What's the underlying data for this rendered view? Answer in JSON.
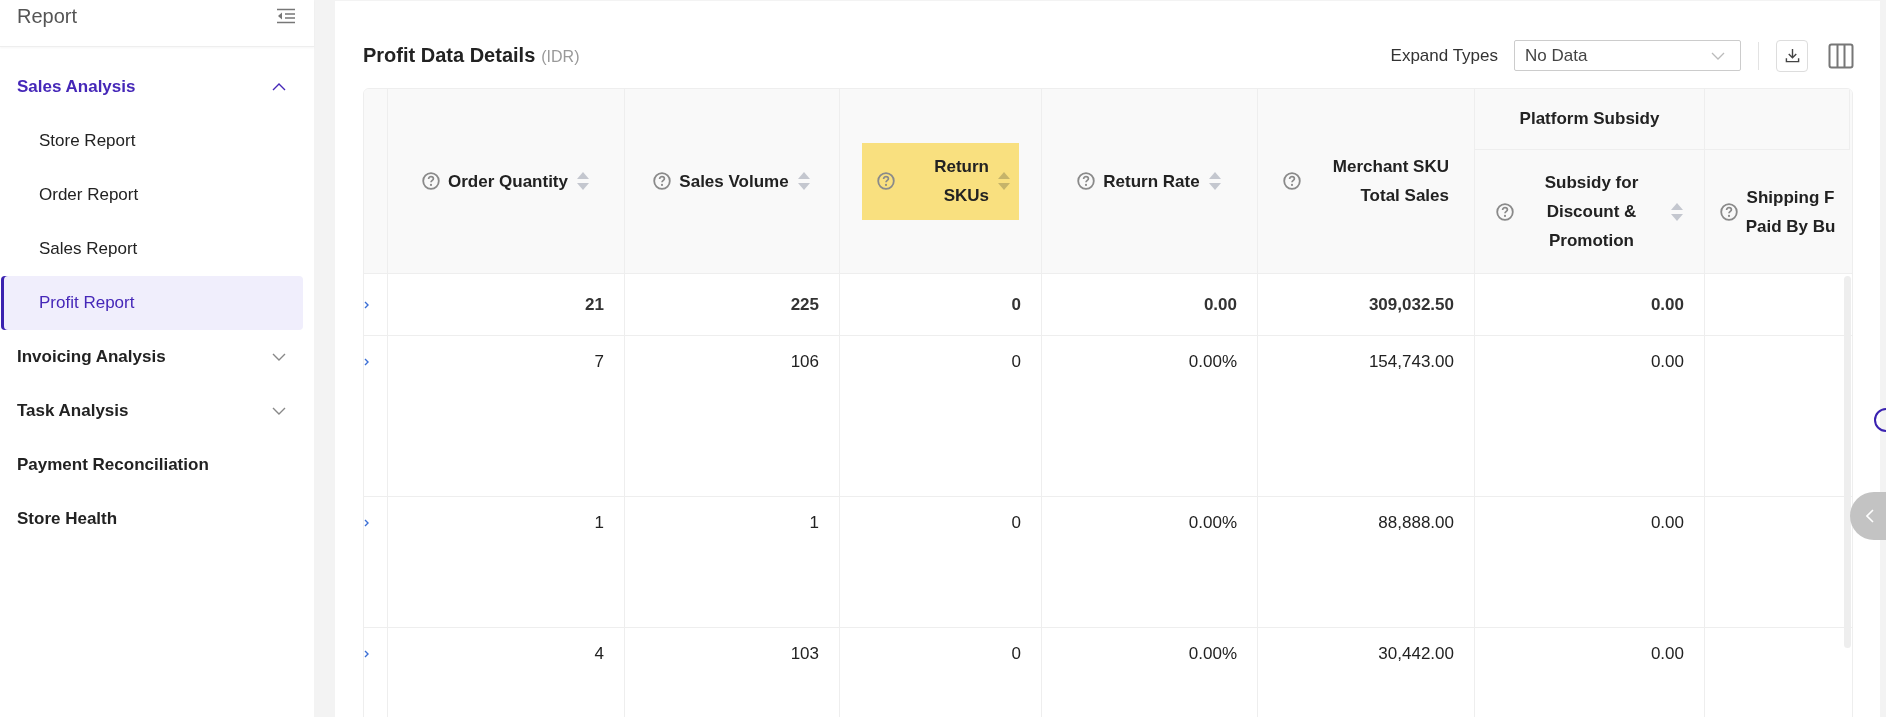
{
  "sidebar": {
    "title": "Report",
    "items": [
      {
        "label": "Sales Analysis",
        "kind": "group",
        "expanded": true,
        "children": [
          {
            "label": "Store Report",
            "selected": false
          },
          {
            "label": "Order Report",
            "selected": false
          },
          {
            "label": "Sales Report",
            "selected": false
          },
          {
            "label": "Profit Report",
            "selected": true
          }
        ]
      },
      {
        "label": "Invoicing Analysis",
        "kind": "group",
        "expanded": false
      },
      {
        "label": "Task Analysis",
        "kind": "group",
        "expanded": false
      },
      {
        "label": "Payment Reconciliation",
        "kind": "link"
      },
      {
        "label": "Store Health",
        "kind": "link"
      }
    ]
  },
  "panel": {
    "title": "Profit Data Details",
    "currency": "(IDR)",
    "expand_label": "Expand Types",
    "expand_select": {
      "value": "No Data"
    }
  },
  "table": {
    "columns": [
      {
        "kind": "single",
        "label": "Order Quantity",
        "sortable": true,
        "highlighted": false
      },
      {
        "kind": "single",
        "label": "Sales Volume",
        "sortable": true,
        "highlighted": false
      },
      {
        "kind": "single",
        "label": "Return SKUs",
        "sortable": true,
        "highlighted": true
      },
      {
        "kind": "single",
        "label": "Return Rate",
        "sortable": true,
        "highlighted": false
      },
      {
        "kind": "single",
        "label": "Merchant SKU Total Sales",
        "sortable": false,
        "highlighted": false
      },
      {
        "kind": "group",
        "title": "Platform Subsidy",
        "columns": [
          {
            "label": "Subsidy for Discount & Promotion",
            "sortable": true,
            "highlighted": false
          }
        ]
      },
      {
        "kind": "group",
        "columns": [
          {
            "label": "Shipping F\nPaid By Bu",
            "sortable": false,
            "highlighted": false
          }
        ]
      }
    ],
    "rows": [
      {
        "total": true,
        "cells": [
          "21",
          "225",
          "0",
          "0.00",
          "309,032.50",
          "0.00"
        ]
      },
      {
        "total": false,
        "cells": [
          "7",
          "106",
          "0",
          "0.00%",
          "154,743.00",
          "0.00"
        ]
      },
      {
        "total": false,
        "cells": [
          "1",
          "1",
          "0",
          "0.00%",
          "88,888.00",
          "0.00"
        ]
      },
      {
        "total": false,
        "cells": [
          "4",
          "103",
          "0",
          "0.00%",
          "30,442.00",
          "0.00"
        ]
      }
    ]
  }
}
